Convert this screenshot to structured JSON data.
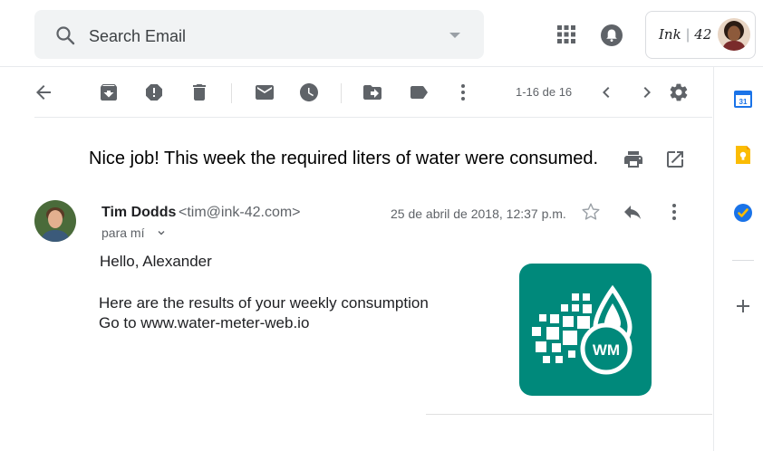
{
  "search": {
    "placeholder": "Search Email"
  },
  "account": {
    "brand": "Ink",
    "brand_num": "42"
  },
  "toolbar": {
    "pager": "1-16 de 16"
  },
  "email": {
    "subject": "Nice job! This week the required liters of water were consumed.",
    "sender_name": "Tim Dodds",
    "sender_email": "<tim@ink-42.com>",
    "to": "para mí",
    "date": "25 de abril de 2018, 12:37 p.m.",
    "greeting": "Hello, Alexander",
    "body_line1": "Here are the results of your weekly consumption",
    "body_line2": "Go to www.water-meter-web.io",
    "logo_text": "WM"
  },
  "colors": {
    "logo_bg": "#00897b",
    "calendar": "#1a73e8",
    "keep": "#fbbc04",
    "tasks": "#1a73e8"
  },
  "icons": {
    "search": "search-icon",
    "apps": "apps-grid-icon",
    "notifications": "bell-icon",
    "back": "arrow-back-icon",
    "archive": "archive-icon",
    "spam": "report-spam-icon",
    "delete": "trash-icon",
    "unread": "mail-icon",
    "snooze": "clock-icon",
    "move": "move-to-icon",
    "label": "label-icon",
    "more": "more-vert-icon",
    "prev": "chevron-left-icon",
    "next": "chevron-right-icon",
    "settings": "gear-icon",
    "print": "print-icon",
    "open_new": "open-in-new-icon",
    "star": "star-icon",
    "reply": "reply-icon"
  }
}
